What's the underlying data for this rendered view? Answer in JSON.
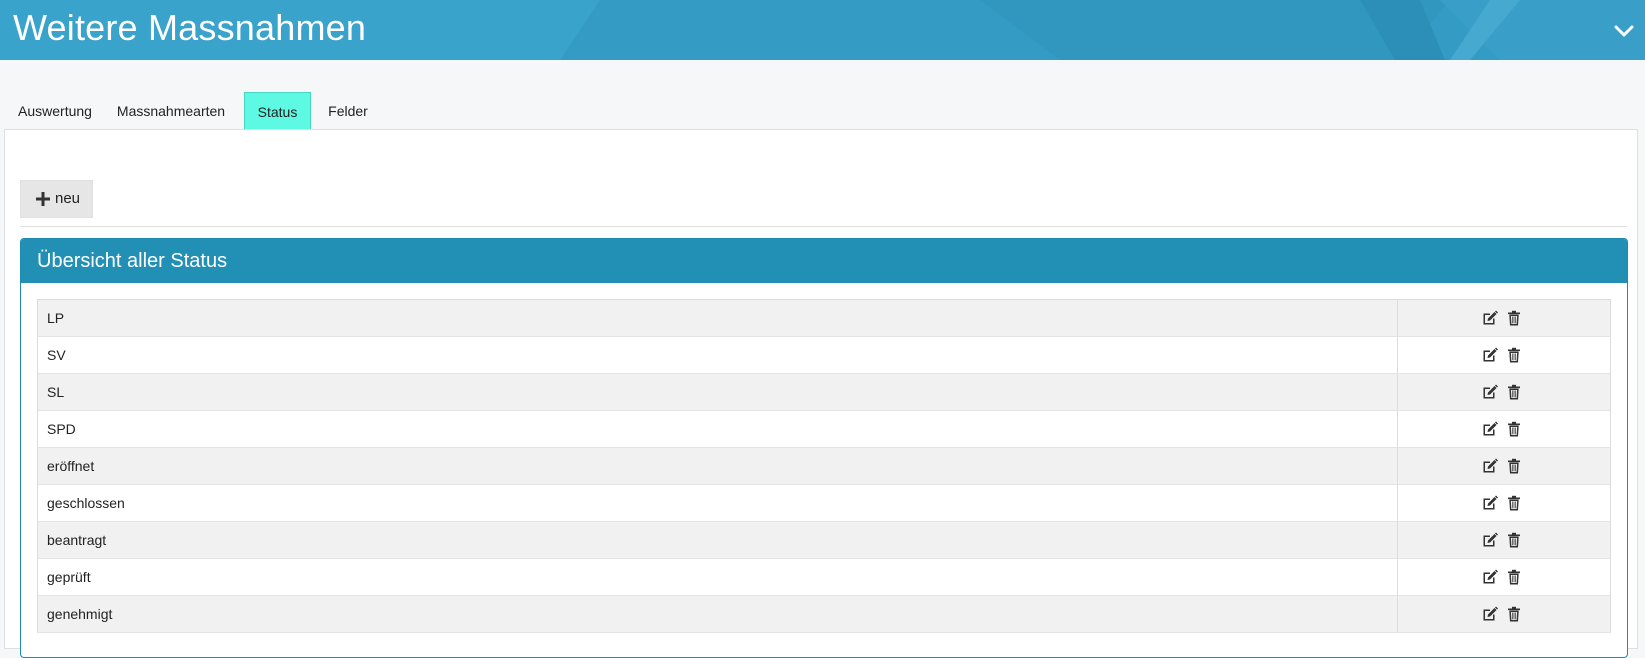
{
  "header": {
    "title": "Weitere Massnahmen",
    "toggle_icon": "chevron-down-icon"
  },
  "tabs": [
    {
      "label": "Auswertung",
      "active": false
    },
    {
      "label": "Massnahmearten",
      "active": false
    },
    {
      "label": "Status",
      "active": true
    },
    {
      "label": "Felder",
      "active": false
    }
  ],
  "toolbar": {
    "new_label": "neu",
    "new_icon": "plus-icon"
  },
  "card": {
    "title": "Übersicht aller Status"
  },
  "table": {
    "rows": [
      {
        "name": "LP"
      },
      {
        "name": "SV"
      },
      {
        "name": "SL"
      },
      {
        "name": "SPD"
      },
      {
        "name": "eröffnet"
      },
      {
        "name": "geschlossen"
      },
      {
        "name": "beantragt"
      },
      {
        "name": "geprüft"
      },
      {
        "name": "genehmigt"
      }
    ],
    "row_actions": [
      "edit-icon",
      "trash-icon"
    ]
  },
  "colors": {
    "header_bg": "#3aa3cb",
    "active_tab": "#5ef9e3",
    "card_header": "#2290b4",
    "row_alt": "#f1f1f1"
  }
}
